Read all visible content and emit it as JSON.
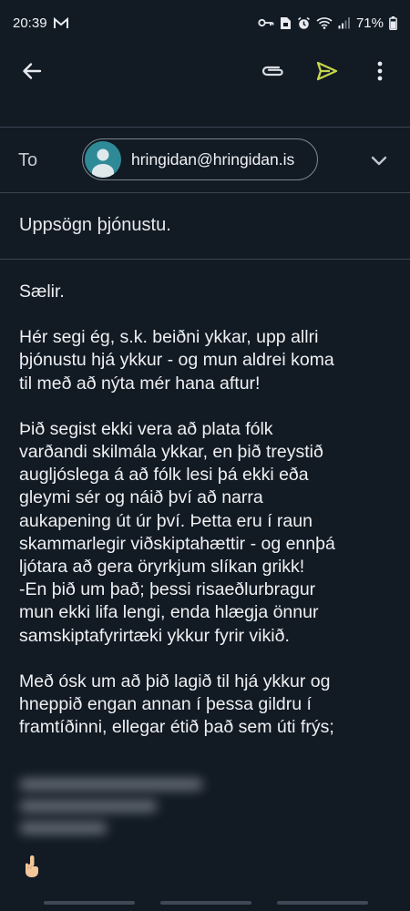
{
  "status_bar": {
    "time": "20:39",
    "battery": "71%",
    "icons": [
      "gmail-icon",
      "key-icon",
      "sim-icon",
      "alarm-icon",
      "wifi-icon",
      "signal-icon",
      "battery-icon"
    ]
  },
  "toolbar": {
    "back_icon": "arrow-left-icon",
    "attach_icon": "paperclip-icon",
    "send_icon": "send-icon",
    "more_icon": "more-vert-icon",
    "send_color": "#c6d64a"
  },
  "compose": {
    "to_label": "To",
    "recipient": "hringidan@hringidan.is",
    "subject": "Uppsögn þjónustu.",
    "body": {
      "greeting": "Sælir.",
      "paragraph1": [
        "Hér segi ég, s.k. beiðni ykkar, upp allri",
        "þjónustu hjá ykkur - og mun aldrei koma",
        "til með að nýta mér hana aftur!"
      ],
      "paragraph2": [
        "Þið segist ekki vera að plata fólk",
        "varðandi skilmála ykkar, en þið treystið",
        "augljóslega á að fólk lesi þá ekki eða",
        "gleymi sér og náið því að narra",
        "aukapening út úr því. Þetta eru í raun",
        "skammarlegir viðskiptahættir - og ennþá",
        "ljótara að gera öryrkjum slíkan grikk!",
        "-En þið um það; þessi risaeðlurbragur",
        "mun ekki lifa lengi, enda hlægja önnur",
        "samskiptafyrirtæki ykkur fyrir vikið."
      ],
      "paragraph3": [
        "Með ósk um að þið lagið til hjá ykkur og",
        "hneppið engan annan í þessa gildru í",
        "framtíðinni, ellegar étið það sem úti frýs;"
      ]
    }
  }
}
